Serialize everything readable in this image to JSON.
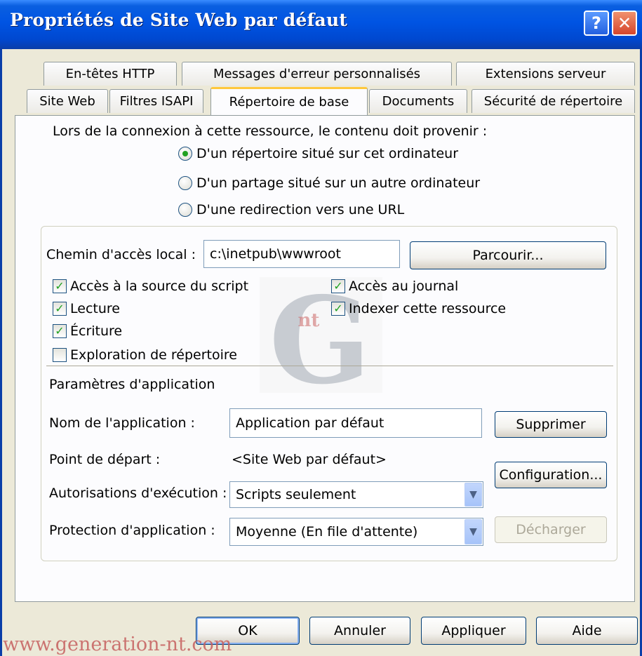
{
  "window": {
    "title": "Propriétés de Site Web par défaut",
    "help_glyph": "?",
    "close_glyph": "✕"
  },
  "tabs": {
    "row1": [
      "En-têtes HTTP",
      "Messages d'erreur personnalisés",
      "Extensions serveur"
    ],
    "row2": [
      "Site Web",
      "Filtres ISAPI",
      "Répertoire de base",
      "Documents",
      "Sécurité de répertoire"
    ],
    "active": "Répertoire de base"
  },
  "source": {
    "heading": "Lors de la connexion à cette ressource, le contenu doit provenir :",
    "options": [
      {
        "label": "D'un répertoire situé sur cet ordinateur",
        "selected": true
      },
      {
        "label": "D'un partage situé sur un autre ordinateur",
        "selected": false
      },
      {
        "label": "D'une redirection vers une URL",
        "selected": false
      }
    ]
  },
  "local_path": {
    "label": "Chemin d'accès local :",
    "value": "c:\\inetpub\\wwwroot",
    "browse_label": "Parcourir..."
  },
  "permissions": {
    "script_source": {
      "label": "Accès à la source du script",
      "checked": true
    },
    "read": {
      "label": "Lecture",
      "checked": true
    },
    "write": {
      "label": "Écriture",
      "checked": true
    },
    "browse": {
      "label": "Exploration de répertoire",
      "checked": false
    },
    "log": {
      "label": "Accès au journal",
      "checked": true
    },
    "index": {
      "label": "Indexer cette ressource",
      "checked": true
    }
  },
  "application": {
    "section_label": "Paramètres d'application",
    "name_label": "Nom de l'application :",
    "name_value": "Application par défaut",
    "remove_label": "Supprimer",
    "start_label": "Point de départ :",
    "start_value": "<Site Web par défaut>",
    "config_label": "Configuration...",
    "exec_label": "Autorisations d'exécution :",
    "exec_value": "Scripts seulement",
    "protection_label": "Protection d'application :",
    "protection_value": "Moyenne (En file d'attente)",
    "unload_label": "Décharger"
  },
  "footer": {
    "ok": "OK",
    "cancel": "Annuler",
    "apply": "Appliquer",
    "help": "Aide"
  },
  "watermark": {
    "text": "www.generation-nt.com",
    "logo_text": "G",
    "logo_small": "nt"
  },
  "colors": {
    "titlebar": "#0054e3",
    "check": "#21a121",
    "accent_tab": "#ffc83c",
    "face": "#ece9d8"
  },
  "icons": {
    "help": "question-icon",
    "close": "close-icon",
    "dropdown": "chevron-down-icon"
  }
}
